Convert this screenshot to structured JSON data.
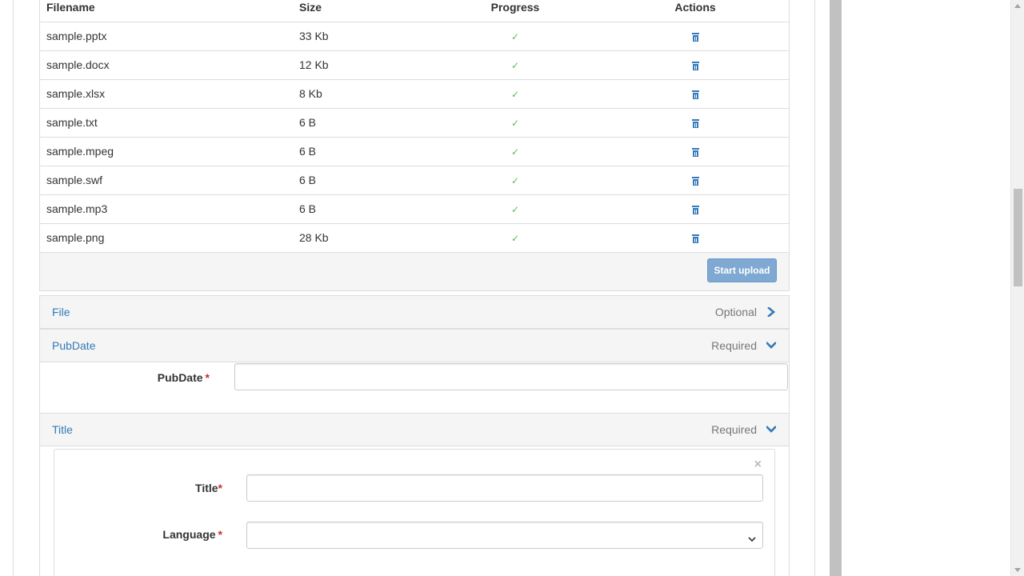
{
  "table": {
    "headers": {
      "filename": "Filename",
      "size": "Size",
      "progress": "Progress",
      "actions": "Actions"
    },
    "rows": [
      {
        "name": "sample.pptx",
        "size": "33 Kb",
        "progress": "✓"
      },
      {
        "name": "sample.docx",
        "size": "12 Kb",
        "progress": "✓"
      },
      {
        "name": "sample.xlsx",
        "size": "8 Kb",
        "progress": "✓"
      },
      {
        "name": "sample.txt",
        "size": "6 B",
        "progress": "✓"
      },
      {
        "name": "sample.mpeg",
        "size": "6 B",
        "progress": "✓"
      },
      {
        "name": "sample.swf",
        "size": "6 B",
        "progress": "✓"
      },
      {
        "name": "sample.mp3",
        "size": "6 B",
        "progress": "✓"
      },
      {
        "name": "sample.png",
        "size": "28 Kb",
        "progress": "✓"
      }
    ],
    "action_icon": "trash-icon",
    "progress_icon": "check-icon"
  },
  "upload": {
    "start_label": "Start upload"
  },
  "sections": {
    "file": {
      "title": "File",
      "status": "Optional",
      "icon": "chevron-right-icon"
    },
    "pubdate": {
      "title": "PubDate",
      "status": "Required",
      "icon": "chevron-down-icon",
      "field_label": "PubDate",
      "required_mark": "*",
      "value": ""
    },
    "title": {
      "title": "Title",
      "status": "Required",
      "icon": "chevron-down-icon",
      "close": "×",
      "title_field_label": "Title",
      "title_required_mark": "*",
      "title_value": "",
      "language_field_label": "Language",
      "language_required_mark": "*",
      "language_value": ""
    }
  },
  "colors": {
    "link": "#337ab7",
    "check": "#5cb85c",
    "required": "#c9302c",
    "button": "#7fa8d3"
  }
}
